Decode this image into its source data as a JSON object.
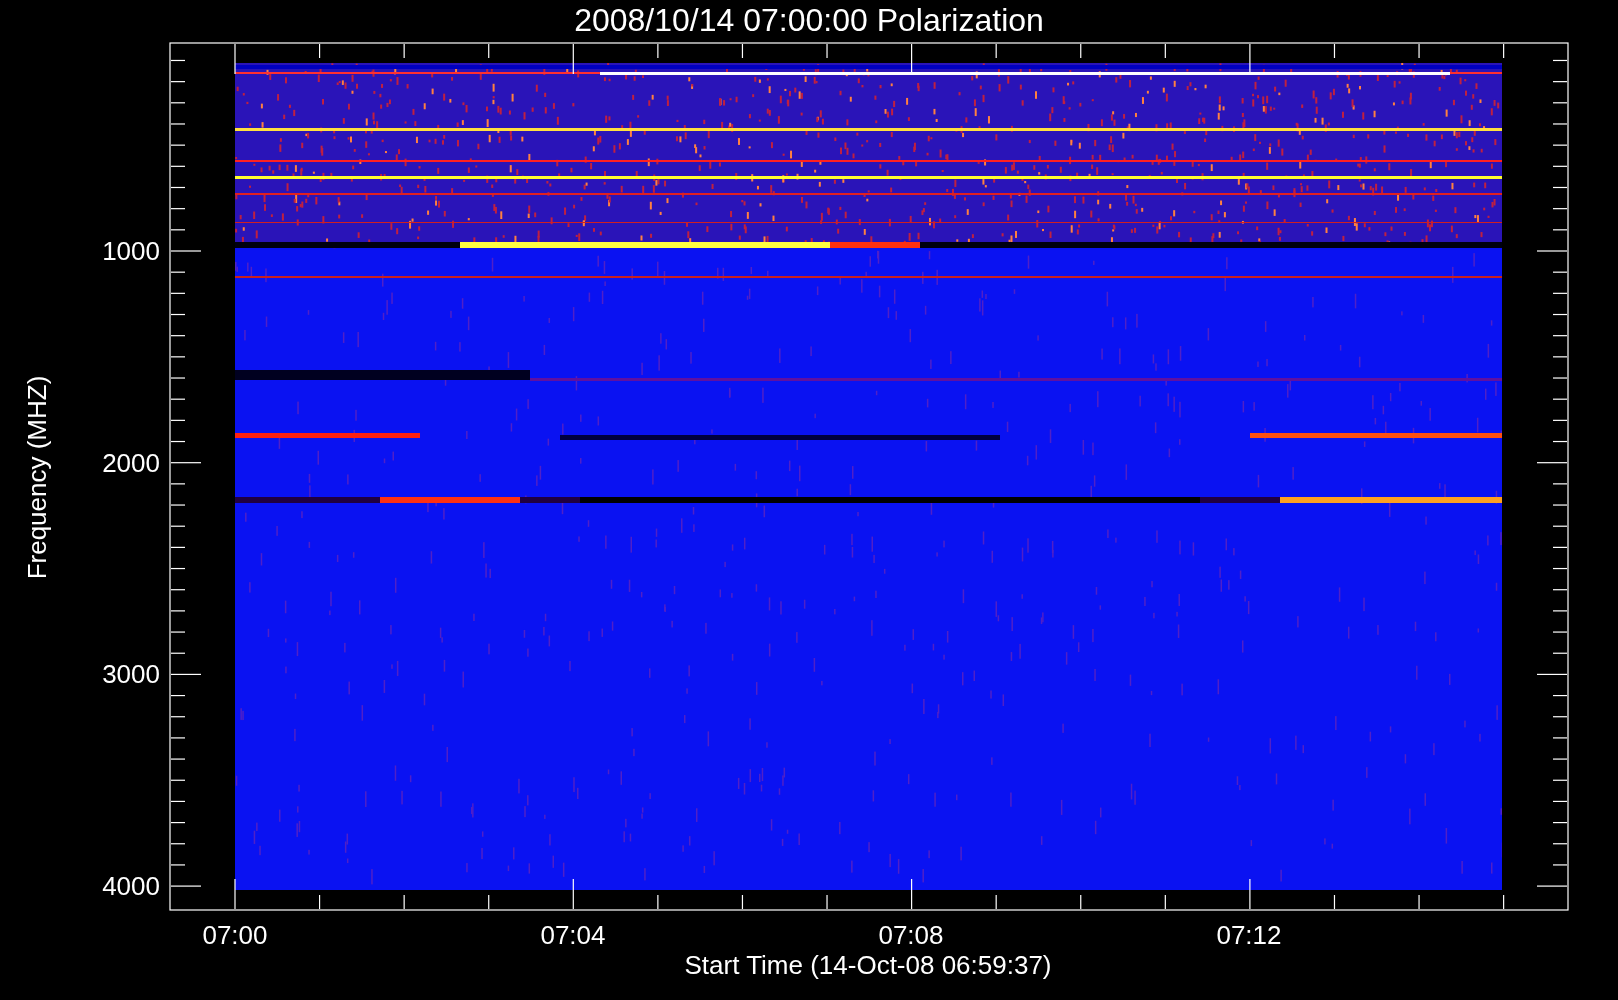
{
  "title": "2008/10/14 07:00:00 Polarization",
  "y_axis": {
    "label": "Frequency (MHZ)",
    "ticks": [
      "1000",
      "2000",
      "3000",
      "4000"
    ]
  },
  "x_axis": {
    "label": "Start Time (14-Oct-08 06:59:37)",
    "ticks": [
      "07:00",
      "07:04",
      "07:08",
      "07:12"
    ]
  }
}
